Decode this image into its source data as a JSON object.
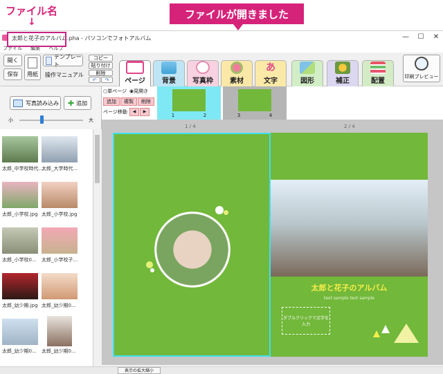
{
  "annotations": {
    "file_name_label": "ファイル名",
    "arrow": "↓",
    "banner": "ファイルが開きました"
  },
  "window": {
    "title": "太郎と花子のアルバム.pha - パソコンでフォトアルバム",
    "menu": [
      "ファイル",
      "編集",
      "ヘルプ"
    ],
    "min": "—",
    "max": "☐",
    "close": "✕"
  },
  "toolbar": {
    "open": "開く",
    "save": "保存",
    "paper": "用紙",
    "template": "テンプレート",
    "manual": "操作マニュアル",
    "copy": "コピー",
    "paste": "貼り付け",
    "delete": "削除",
    "undo": "↶",
    "redo": "↷",
    "print_preview": "印刷プレビュー"
  },
  "tabs": [
    {
      "label": "ページ",
      "icon": "book-icon",
      "color": "#ffffff"
    },
    {
      "label": "背景",
      "icon": "background-icon",
      "color": "#bfe4f4"
    },
    {
      "label": "写真枠",
      "icon": "photo-frame-icon",
      "color": "#f8d2e0"
    },
    {
      "label": "素材",
      "icon": "material-icon",
      "color": "#fbe8a8"
    },
    {
      "label": "文字",
      "icon": "text-icon",
      "color": "#fbe9a8"
    },
    {
      "label": "図形",
      "icon": "shape-icon",
      "color": "#d2eec7"
    },
    {
      "label": "補正",
      "icon": "adjust-icon",
      "color": "#dcd7f0"
    },
    {
      "label": "配置",
      "icon": "layout-icon",
      "color": "#d4ecc6"
    }
  ],
  "left_panel": {
    "import": "写真読み込み",
    "add": "追加",
    "size_small": "小",
    "size_large": "大",
    "slider_value": 0.35,
    "photos": [
      "太郎_中学校時代...",
      "太郎_大学時代...",
      "太郎_小学校.jpg",
      "太郎_小学校.jpg",
      "太郎_小学校0...",
      "太郎_小学校子...",
      "太郎_幼少期.jpg",
      "太郎_幼少期0...",
      "太郎_幼少期0...",
      "太郎_幼少期0..."
    ]
  },
  "page_strip": {
    "single": "単ページ",
    "spread": "見開き",
    "add": "追加",
    "duplicate": "複製",
    "remove": "削除",
    "move": "ページ移動",
    "left_arrow": "◀",
    "right_arrow": "▶",
    "page_numbers": [
      "1",
      "2",
      "3",
      "4"
    ]
  },
  "canvas": {
    "left_page_num": "1 / 4",
    "right_page_num": "2 / 4",
    "album_title": "太郎と花子のアルバム",
    "sample": "text sample text sample",
    "textbox": "ダブルクリックで文字を入力"
  },
  "status": {
    "zoom_button": "表示の拡大縮小"
  },
  "colors": {
    "accent": "#d6237a",
    "page_green": "#72b83a",
    "selection": "#3ee0f0"
  }
}
